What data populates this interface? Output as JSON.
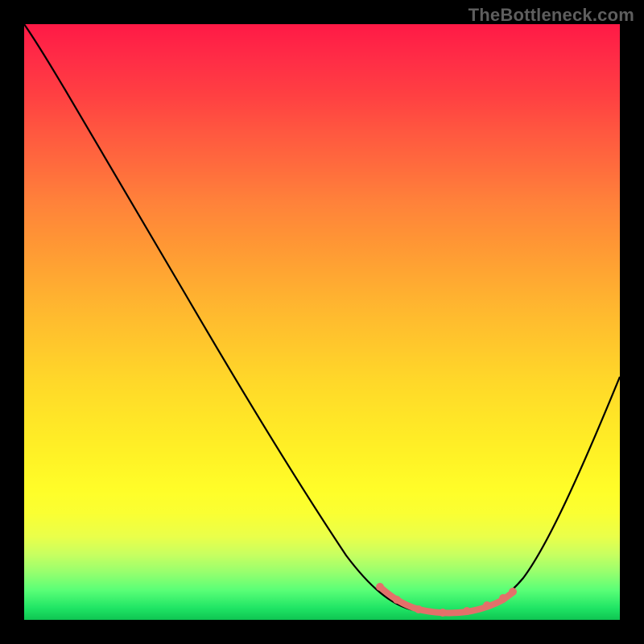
{
  "watermark": "TheBottleneck.com",
  "chart_data": {
    "type": "line",
    "title": "",
    "xlabel": "",
    "ylabel": "",
    "xlim": [
      0,
      100
    ],
    "ylim": [
      0,
      100
    ],
    "gradient_stops": [
      {
        "pos": 0,
        "color": "#ff1a46"
      },
      {
        "pos": 12,
        "color": "#ff4042"
      },
      {
        "pos": 24,
        "color": "#ff6c3d"
      },
      {
        "pos": 36,
        "color": "#ff9435"
      },
      {
        "pos": 48,
        "color": "#ffb82f"
      },
      {
        "pos": 60,
        "color": "#ffd829"
      },
      {
        "pos": 72,
        "color": "#fff126"
      },
      {
        "pos": 82,
        "color": "#faff32"
      },
      {
        "pos": 89,
        "color": "#c8ff60"
      },
      {
        "pos": 95,
        "color": "#5aff77"
      },
      {
        "pos": 100,
        "color": "#0fc552"
      }
    ],
    "series": [
      {
        "name": "main-curve",
        "color": "#000000",
        "points": [
          {
            "x": 0,
            "y": 100
          },
          {
            "x": 4,
            "y": 96
          },
          {
            "x": 8,
            "y": 91
          },
          {
            "x": 12,
            "y": 85
          },
          {
            "x": 20,
            "y": 71
          },
          {
            "x": 28,
            "y": 58
          },
          {
            "x": 36,
            "y": 44
          },
          {
            "x": 44,
            "y": 30
          },
          {
            "x": 52,
            "y": 17
          },
          {
            "x": 58,
            "y": 8
          },
          {
            "x": 62,
            "y": 4
          },
          {
            "x": 66,
            "y": 2
          },
          {
            "x": 70,
            "y": 1.3
          },
          {
            "x": 74,
            "y": 1.3
          },
          {
            "x": 78,
            "y": 2
          },
          {
            "x": 82,
            "y": 4.5
          },
          {
            "x": 86,
            "y": 10
          },
          {
            "x": 90,
            "y": 18
          },
          {
            "x": 95,
            "y": 29
          },
          {
            "x": 100,
            "y": 41
          }
        ]
      },
      {
        "name": "highlight-segment",
        "color": "#e3706a",
        "thick": true,
        "points": [
          {
            "x": 60,
            "y": 5.5
          },
          {
            "x": 63,
            "y": 3.4
          },
          {
            "x": 66,
            "y": 2.1
          },
          {
            "x": 69,
            "y": 1.4
          },
          {
            "x": 72,
            "y": 1.3
          },
          {
            "x": 75,
            "y": 1.5
          },
          {
            "x": 78,
            "y": 2.1
          },
          {
            "x": 80,
            "y": 2.9
          },
          {
            "x": 82,
            "y": 4.3
          }
        ]
      }
    ]
  }
}
